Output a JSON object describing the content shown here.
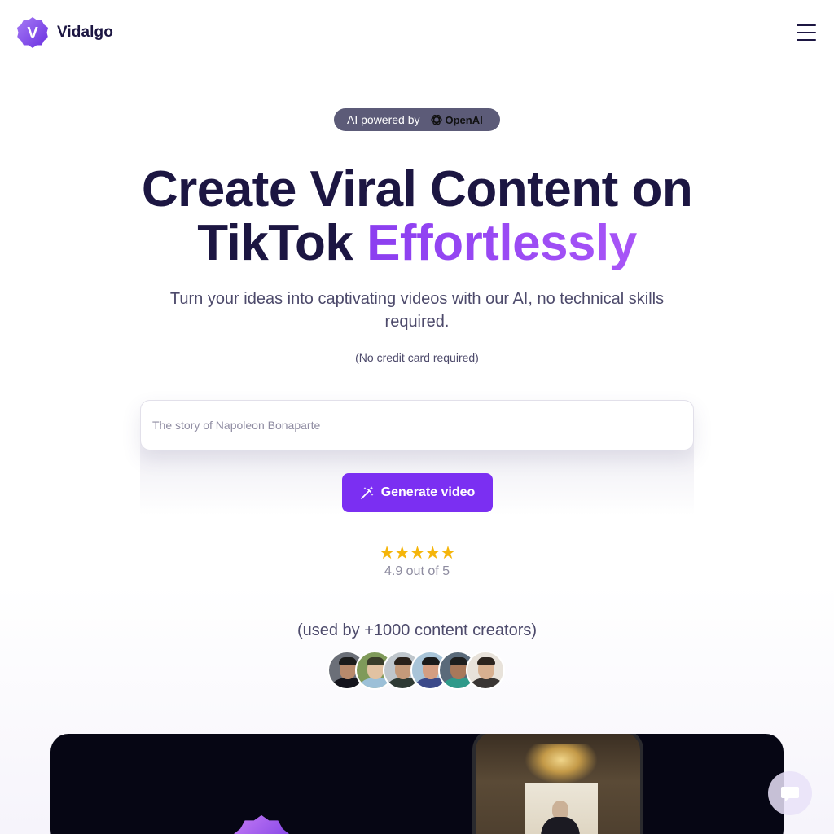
{
  "header": {
    "brand_name": "Vidalgo",
    "logo_letter": "V"
  },
  "badge": {
    "label": "AI powered by",
    "partner": "OpenAI"
  },
  "hero": {
    "title_line1": "Create Viral Content on",
    "title_line2_plain": "TikTok",
    "title_line2_accent": "Effortlessly",
    "subtitle": "Turn your ideas into captivating videos with our AI, no technical skills required.",
    "note": "(No credit card required)"
  },
  "prompt": {
    "placeholder": "The story of Napoleon Bonaparte",
    "value": ""
  },
  "generate_button": {
    "label": "Generate video"
  },
  "rating": {
    "stars": "★★★★★",
    "value": 4.9,
    "text": "4.9 out of 5"
  },
  "social_proof": {
    "text": "(used by +1000 content creators)",
    "avatars": [
      {
        "name": "creator-1",
        "skin": "#b88a6c",
        "hair": "#1b1b1b",
        "shirt": "#14141c",
        "bg": "#6b6f78"
      },
      {
        "name": "creator-2",
        "skin": "#e2c2a2",
        "hair": "#3a3d2a",
        "shirt": "#9cc0d8",
        "bg": "#7f9a5a"
      },
      {
        "name": "creator-3",
        "skin": "#c59a7a",
        "hair": "#2a211a",
        "shirt": "#2e3a34",
        "bg": "#bfc6cc"
      },
      {
        "name": "creator-4",
        "skin": "#d49e82",
        "hair": "#1a1a1a",
        "shirt": "#3c4a8a",
        "bg": "#a8c4d8"
      },
      {
        "name": "creator-5",
        "skin": "#a8785a",
        "hair": "#1e1e1e",
        "shirt": "#2f9a8a",
        "bg": "#5a6a7a"
      },
      {
        "name": "creator-6",
        "skin": "#d8b090",
        "hair": "#2c241e",
        "shirt": "#3a3634",
        "bg": "#e8e2da"
      }
    ]
  },
  "colors": {
    "brand": "#7b2ff2",
    "heading": "#1c1642",
    "star": "#f5b50a",
    "card": "#060614"
  },
  "icons": [
    "menu-icon",
    "openai-icon",
    "magic-wand-icon",
    "star-icon",
    "chat-icon"
  ]
}
